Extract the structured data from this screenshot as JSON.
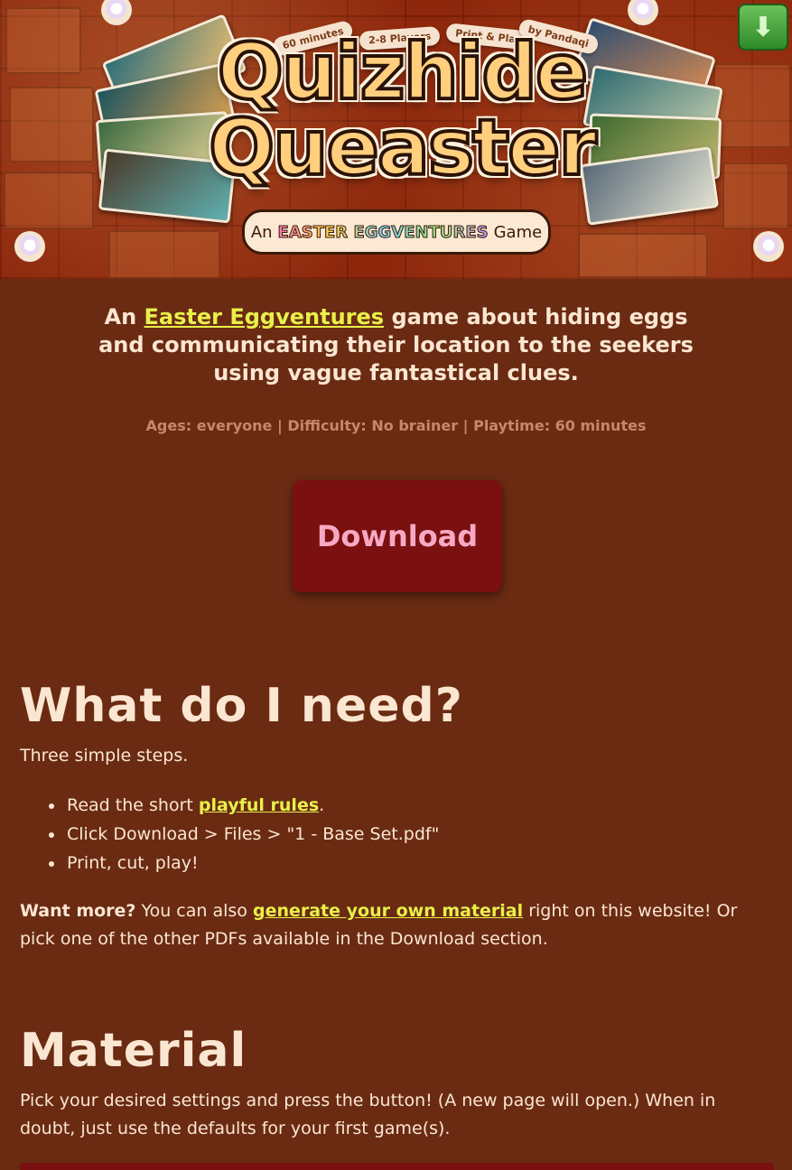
{
  "header": {
    "title_line1": "Quizhide",
    "title_line2": "Queaster",
    "subtitle_prefix": "An",
    "subtitle_brand": "EASTER EGGVENTURES",
    "subtitle_suffix": "Game",
    "badges": [
      "60 minutes",
      "2-8 Players",
      "Print & Play",
      "by Pandaqi"
    ],
    "download_icon": "download-arrow-icon"
  },
  "intro": {
    "tagline_prefix": "An",
    "tagline_link": "Easter Eggventures",
    "tagline_rest": "game about hiding eggs and communicating their location to the seekers using vague fantastical clues.",
    "meta": "Ages: everyone | Difficulty: No brainer | Playtime: 60 minutes",
    "download_label": "Download"
  },
  "need": {
    "heading": "What do I need?",
    "lead": "Three simple steps.",
    "step1_prefix": "Read the short",
    "step1_link": "playful rules",
    "step1_suffix": ".",
    "step2": "Click Download > Files > \"1 - Base Set.pdf\"",
    "step3": "Print, cut, play!",
    "more_bold": "Want more?",
    "more_prefix": "You can also",
    "more_link": "generate your own material",
    "more_suffix": "right on this website! Or pick one of the other PDFs available in the Download section."
  },
  "material": {
    "heading": "Material",
    "text": "Pick your desired settings and press the button! (A new page will open.) When in doubt, just use the defaults for your first game(s)."
  },
  "colors": {
    "background": "#6a2b12",
    "text": "#fbe6d2",
    "link": "#e8f04a",
    "button": "#7b1010",
    "button_text": "#f7a9c4",
    "meta": "#c9866a"
  }
}
